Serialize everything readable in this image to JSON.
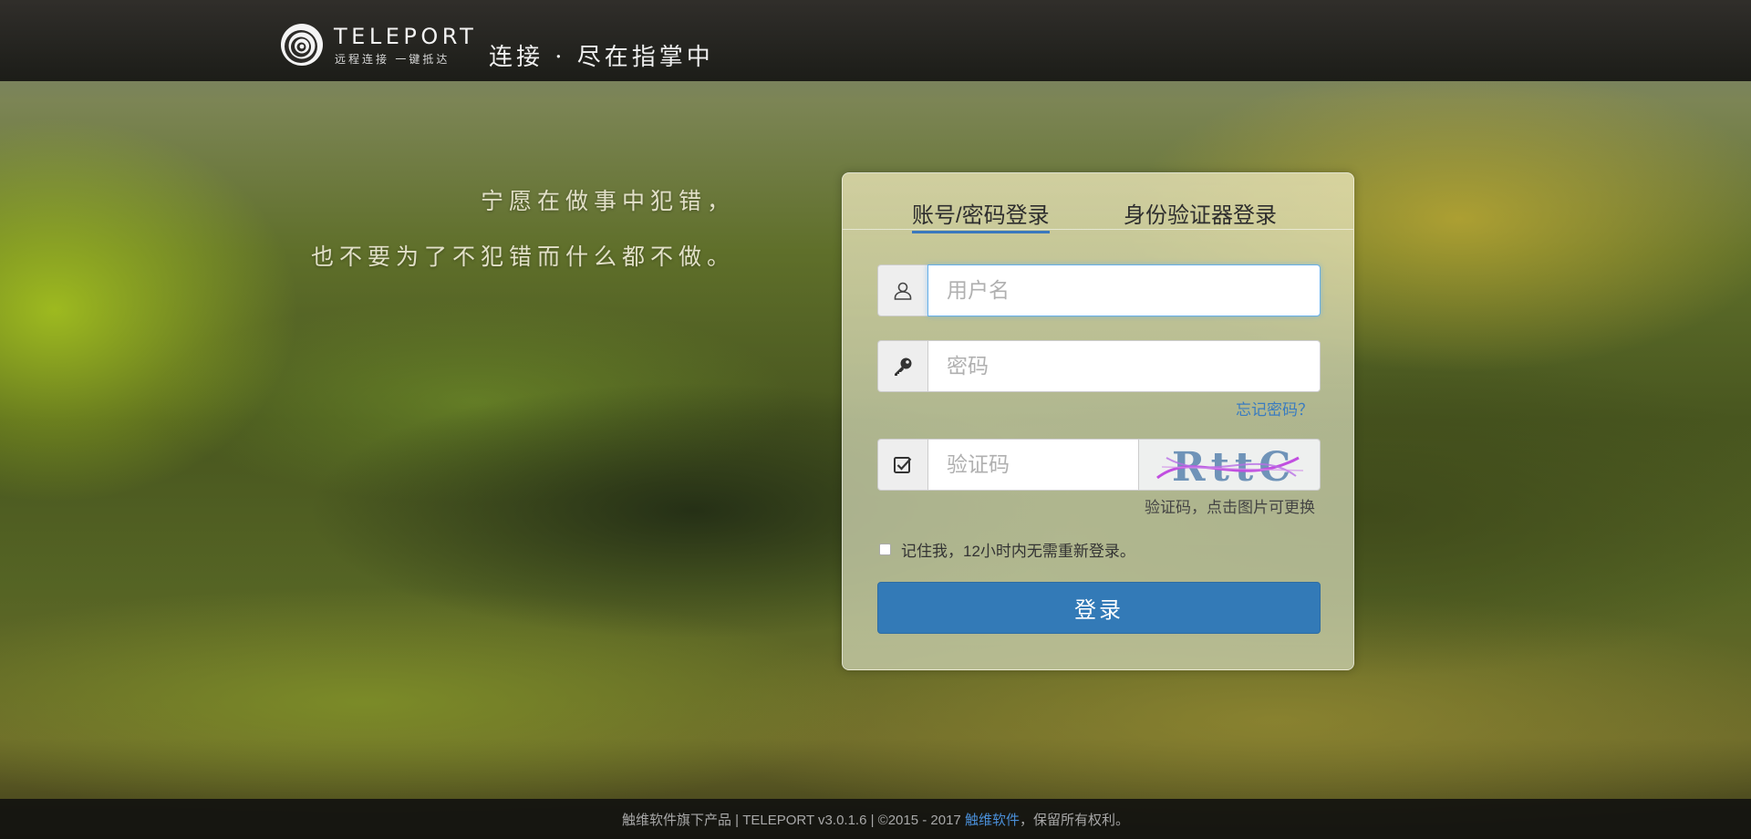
{
  "header": {
    "logo_name": "TELEPORT",
    "logo_sub": "远程连接 一键抵达",
    "slogan": "连接 · 尽在指掌中"
  },
  "quote": {
    "line1": "宁愿在做事中犯错，",
    "line2": "也不要为了不犯错而什么都不做。"
  },
  "login": {
    "tabs": [
      {
        "label": "账号/密码登录",
        "active": true
      },
      {
        "label": "身份验证器登录",
        "active": false
      }
    ],
    "username": {
      "placeholder": "用户名",
      "value": ""
    },
    "password": {
      "placeholder": "密码",
      "value": ""
    },
    "forgot_label": "忘记密码？",
    "captcha": {
      "placeholder": "验证码",
      "value": "",
      "image_text": "RttC",
      "hint": "验证码，点击图片可更换"
    },
    "remember_label": "记住我，12小时内无需重新登录。",
    "remember_checked": false,
    "submit_label": "登录"
  },
  "footer": {
    "prefix": "触维软件旗下产品 | TELEPORT v3.0.1.6 | ©2015 - 2017 ",
    "link": "触维软件",
    "suffix": "，保留所有权利。"
  },
  "colors": {
    "accent": "#337ab7",
    "link": "#3a7cc0",
    "focus_border": "#66afe9"
  },
  "icons": [
    "teleport-logo-icon",
    "user-icon",
    "key-icon",
    "checkbox-icon",
    "captcha-image"
  ]
}
